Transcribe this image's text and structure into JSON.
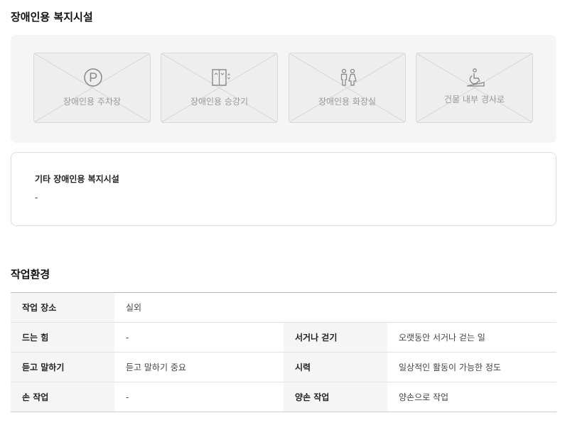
{
  "facilities": {
    "title": "장애인용 복지시설",
    "items": [
      {
        "label": "장애인용 주차장",
        "icon": "parking-icon"
      },
      {
        "label": "장애인용 승강기",
        "icon": "elevator-icon"
      },
      {
        "label": "장애인용 화장실",
        "icon": "restroom-icon"
      },
      {
        "label": "건물 내부 경사로",
        "icon": "wheelchair-ramp-icon"
      }
    ],
    "other": {
      "title": "기타 장애인용 복지시설",
      "value": "-"
    }
  },
  "work_env": {
    "title": "작업환경",
    "rows": [
      {
        "k1": "작업 장소",
        "v1": "실외"
      },
      {
        "k1": "드는 힘",
        "v1": "-",
        "k2": "서거나 걷기",
        "v2": "오랫동안 서거나 걷는 일"
      },
      {
        "k1": "듣고 말하기",
        "v1": "듣고 말하기 중요",
        "k2": "시력",
        "v2": "일상적인 활동이 가능한 정도"
      },
      {
        "k1": "손 작업",
        "v1": "-",
        "k2": "양손 작업",
        "v2": "양손으로 작업"
      }
    ]
  }
}
